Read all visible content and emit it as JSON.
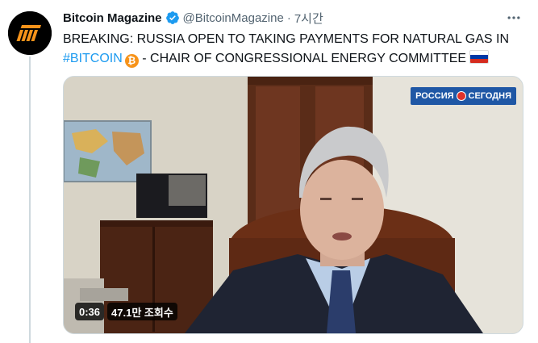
{
  "tweet": {
    "author": {
      "display_name": "Bitcoin Magazine",
      "handle": "@BitcoinMagazine",
      "verified": true
    },
    "separator": "·",
    "time": "7시간",
    "text": {
      "line1": "BREAKING: RUSSIA OPEN TO TAKING PAYMENTS FOR NATURAL GAS IN",
      "hashtag": "#BITCOIN",
      "bitcoin_emoji": "₿",
      "line2_rest": " - CHAIR OF CONGRESSIONAL ENERGY COMMITTEE"
    },
    "flag_icon": "russia-flag-icon",
    "more_icon": "more-icon"
  },
  "video": {
    "channel_logo": {
      "left": "РОССИЯ",
      "right": "СЕГОДНЯ"
    },
    "duration": "0:36",
    "views": "47.1만 조회수"
  },
  "colors": {
    "link": "#1d9bf0",
    "secondary_text": "#536471",
    "verified": "#1d9bf0",
    "bitcoin_orange": "#f7931a"
  }
}
